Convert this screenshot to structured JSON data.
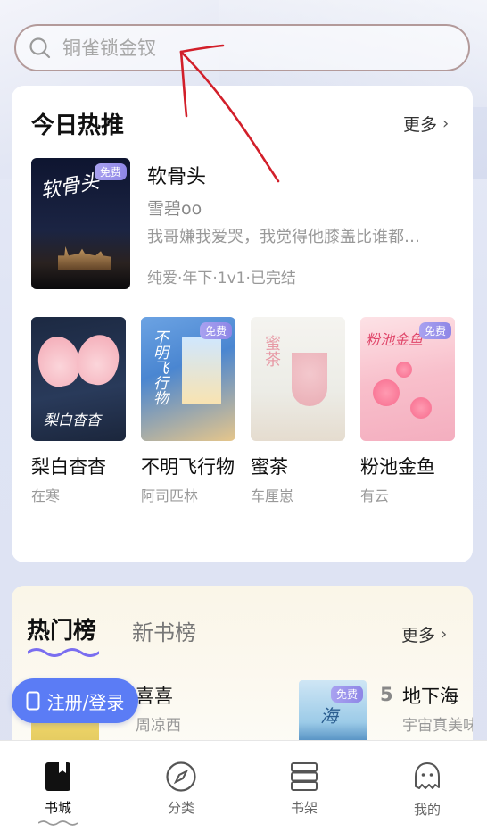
{
  "search": {
    "placeholder": "铜雀锁金钗"
  },
  "hot": {
    "title": "今日热推",
    "more_label": "更多",
    "featured": {
      "cover_text": "软骨头",
      "badge": "免费",
      "title": "软骨头",
      "author": "雪碧oo",
      "description": "我哥嫌我爱哭，我觉得他膝盖比谁都…",
      "tags": "纯爱·年下·1v1·已完结"
    },
    "books": [
      {
        "title": "梨白杳杳",
        "author": "在寒",
        "cover_text": "梨白杳杳",
        "badge": ""
      },
      {
        "title": "不明飞行物",
        "author": "阿司匹林",
        "cover_text": "不明飞行物",
        "badge": "免费"
      },
      {
        "title": "蜜茶",
        "author": "车厘崽",
        "cover_text": "蜜茶",
        "badge": ""
      },
      {
        "title": "粉池金鱼",
        "author": "有云",
        "cover_text": "粉池金鱼",
        "badge": "免费"
      }
    ]
  },
  "ranking": {
    "tabs": [
      {
        "label": "热门榜",
        "active": true
      },
      {
        "label": "新书榜",
        "active": false
      }
    ],
    "more_label": "更多",
    "items": [
      {
        "title": "喜喜",
        "author": "周凉西"
      },
      {
        "rank": "5",
        "title": "地下海",
        "author": "宇宙真美味",
        "badge": "免费",
        "cover_text": "海"
      }
    ]
  },
  "register_button": {
    "label": "注册/登录"
  },
  "nav": [
    {
      "label": "书城",
      "icon": "book-city-icon",
      "active": true
    },
    {
      "label": "分类",
      "icon": "compass-icon",
      "active": false
    },
    {
      "label": "书架",
      "icon": "bookshelf-icon",
      "active": false
    },
    {
      "label": "我的",
      "icon": "ghost-profile-icon",
      "active": false
    }
  ],
  "colors": {
    "accent": "#5b7cf5",
    "badge": "#9d96ec",
    "annotation_arrow": "#d21f2a",
    "wave": "#7a6ef0"
  }
}
